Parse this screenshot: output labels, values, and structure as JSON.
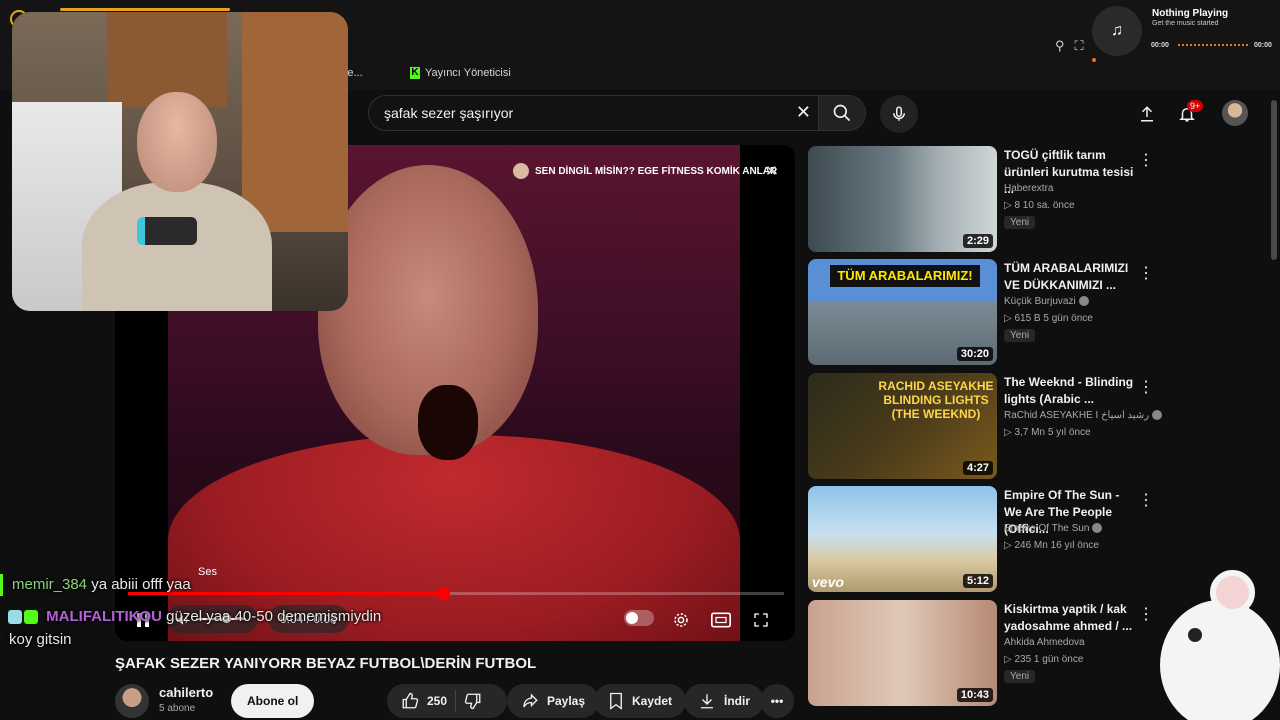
{
  "browser": {
    "bookmarks": [
      {
        "label": "ng Stre..."
      },
      {
        "label": "Yayıncı Yöneticisi"
      }
    ]
  },
  "now_playing": {
    "title": "Nothing Playing",
    "subtitle": "Get the music started",
    "time_start": "00:00",
    "time_end": "00:00"
  },
  "search": {
    "value": "şafak sezer şaşırıyor"
  },
  "header": {
    "notification_count": "9+"
  },
  "player": {
    "overlay_title": "SEN DİNGİL MİSİN?? EGE FİTNESS KOMİK ANLAR",
    "tooltip": "Ses",
    "progress": 0.48,
    "volume": 0.6,
    "time_label": "0:04 / 0:08"
  },
  "chat": {
    "messages": [
      {
        "user": "memir_384",
        "text": "ya abiii offf yaa"
      },
      {
        "user": "MALIFALITIKOU",
        "text": "güzel yaa 40-50 dememişmiydin"
      },
      {
        "user": "",
        "text": "koy gitsin"
      }
    ]
  },
  "video": {
    "title": "ŞAFAK SEZER YANIYORR BEYAZ FUTBOL\\DERİN FUTBOL",
    "channel": "cahilerto",
    "subscribers": "5 abone",
    "subscribe_label": "Abone ol",
    "like_count": "250",
    "share_label": "Paylaş",
    "save_label": "Kaydet",
    "download_label": "İndir"
  },
  "recommended": [
    {
      "title": "TOGÜ çiftlik tarım ürünleri kurutma tesisi ...",
      "channel": "Haberextra",
      "meta": "▷ 8   10 sa. önce",
      "badge": "Yeni",
      "duration": "2:29"
    },
    {
      "title": "TÜM ARABALARIMIZI VE DÜKKANIMIZI ...",
      "channel": "Küçük Burjuvazi",
      "meta": "▷ 615 B   5 gün önce",
      "badge": "Yeni",
      "duration": "30:20",
      "thumb_text": "TÜM ARABALARIMIZ!"
    },
    {
      "title": "The Weeknd - Blinding lights (Arabic ...",
      "channel": "RaChid ASEYAKHE I رشيد اسياخ",
      "meta": "▷ 3,7 Mn   5 yıl önce",
      "badge": "",
      "duration": "4:27",
      "thumb_text": "RACHID ASEYAKHE BLINDING LIGHTS (THE WEEKND)"
    },
    {
      "title": "Empire Of The Sun - We Are The People (Offici...",
      "channel": "Empire Of The Sun",
      "meta": "▷ 246 Mn   16 yıl önce",
      "badge": "",
      "duration": "5:12",
      "thumb_text": "vevo"
    },
    {
      "title": "Kiskirtma yaptik / kak yadosahme ahmed / ...",
      "channel": "Ahkida Ahmedova",
      "meta": "▷ 235   1 gün önce",
      "badge": "Yeni",
      "duration": "10:43"
    }
  ],
  "colors": {
    "accent": "#ff0000",
    "kick_green": "#53fc18",
    "brand_orange": "#e8a31c"
  }
}
